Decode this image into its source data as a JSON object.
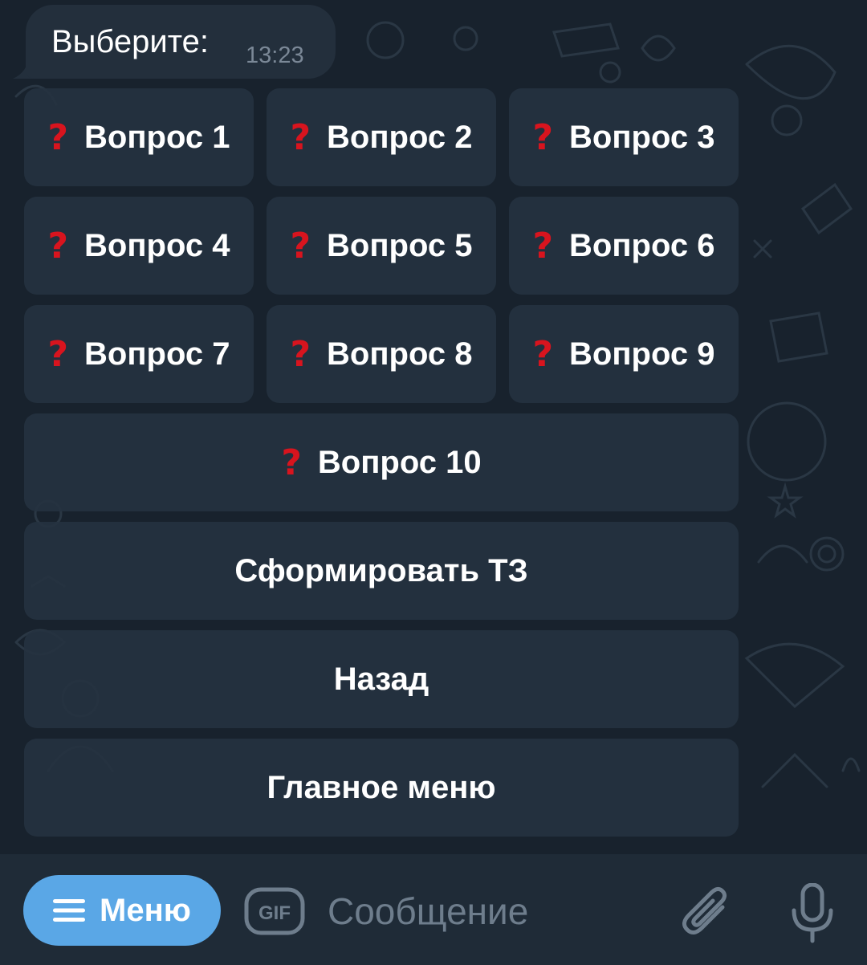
{
  "message": {
    "text": "Выберите:",
    "time": "13:23"
  },
  "keyboard": {
    "q_icon": "?",
    "q1": "Вопрос 1",
    "q2": "Вопрос 2",
    "q3": "Вопрос 3",
    "q4": "Вопрос 4",
    "q5": "Вопрос 5",
    "q6": "Вопрос 6",
    "q7": "Вопрос 7",
    "q8": "Вопрос 8",
    "q9": "Вопрос 9",
    "q10": "Вопрос 10",
    "form_tz": "Сформировать ТЗ",
    "back": "Назад",
    "main_menu": "Главное меню"
  },
  "input_bar": {
    "menu_label": "Меню",
    "gif_label": "GIF",
    "placeholder": "Сообщение"
  },
  "colors": {
    "chat_background": "#18222d",
    "button_background": "#253240",
    "question_mark": "#d8141e",
    "menu_button": "#5aa7e6",
    "input_bar": "#1f2b37"
  },
  "icons": {
    "question": "red-question-mark-icon",
    "menu": "hamburger-icon",
    "gif": "gif-icon",
    "attach": "paperclip-icon",
    "voice": "microphone-icon"
  }
}
